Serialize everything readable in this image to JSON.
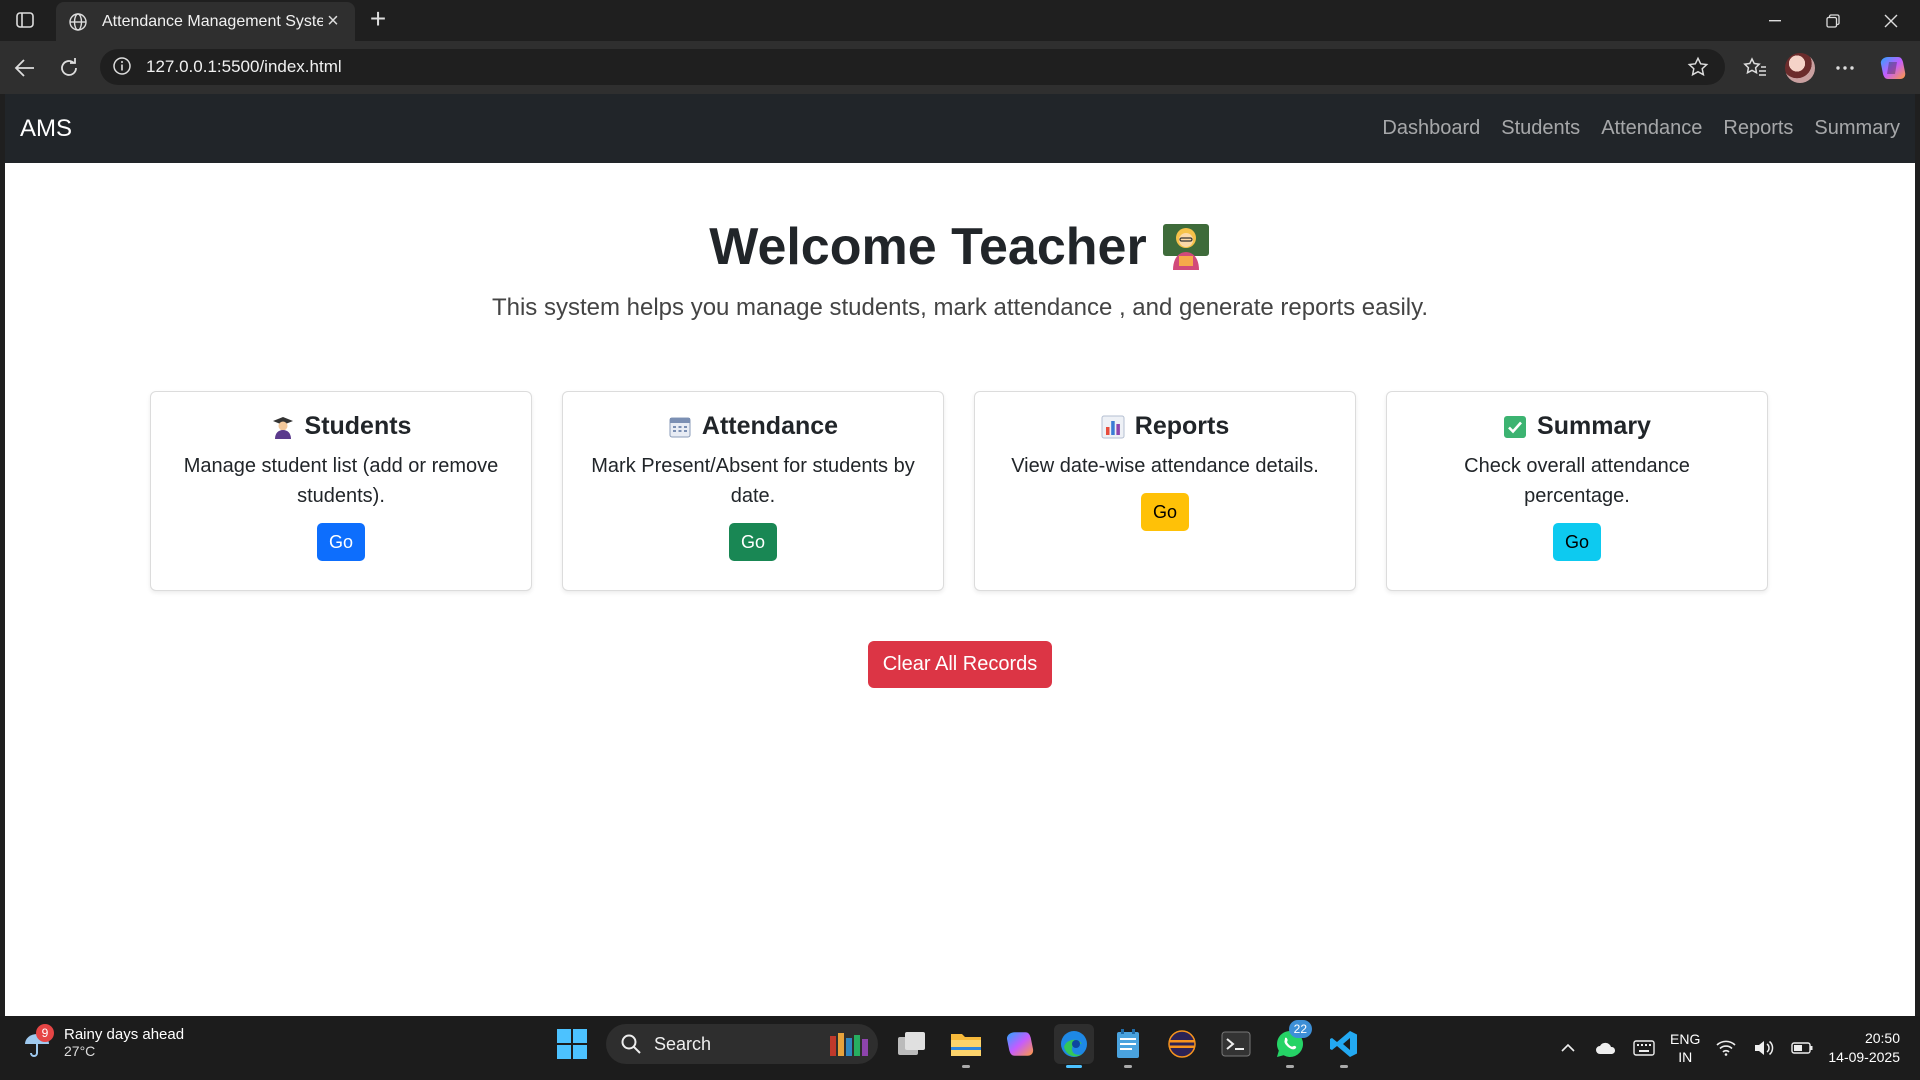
{
  "browser": {
    "tab_title": "Attendance Management System",
    "new_tab_label": "+",
    "url": "127.0.0.1:5500/index.html"
  },
  "page": {
    "brand": "AMS",
    "nav": [
      "Dashboard",
      "Students",
      "Attendance",
      "Reports",
      "Summary"
    ],
    "hero_title": "Welcome Teacher",
    "hero_subtitle": "This system helps you manage students, mark attendance , and generate reports easily.",
    "cards": [
      {
        "title": "Students",
        "icon": "student-icon",
        "description": "Manage student list (add or remove students).",
        "button": "Go",
        "button_color": "#0d6efd"
      },
      {
        "title": "Attendance",
        "icon": "calendar-icon",
        "description": "Mark Present/Absent for students by date.",
        "button": "Go",
        "button_color": "#198754"
      },
      {
        "title": "Reports",
        "icon": "bar-chart-icon",
        "description": "View date-wise attendance details.",
        "button": "Go",
        "button_color": "#ffc107"
      },
      {
        "title": "Summary",
        "icon": "check-mark-icon",
        "description": "Check overall attendance percentage.",
        "button": "Go",
        "button_color": "#0dcaf0"
      }
    ],
    "clear_button": "Clear All Records"
  },
  "taskbar": {
    "weather_badge": "9",
    "weather_text": "Rainy days ahead",
    "weather_temp": "27°C",
    "search_label": "Search",
    "whatsapp_count": "22",
    "lang_line1": "ENG",
    "lang_line2": "IN",
    "time": "20:50",
    "date": "14-09-2025"
  },
  "colors": {
    "navbar_bg": "#212529",
    "danger": "#dc3545",
    "accent": "#4cc2ff"
  }
}
